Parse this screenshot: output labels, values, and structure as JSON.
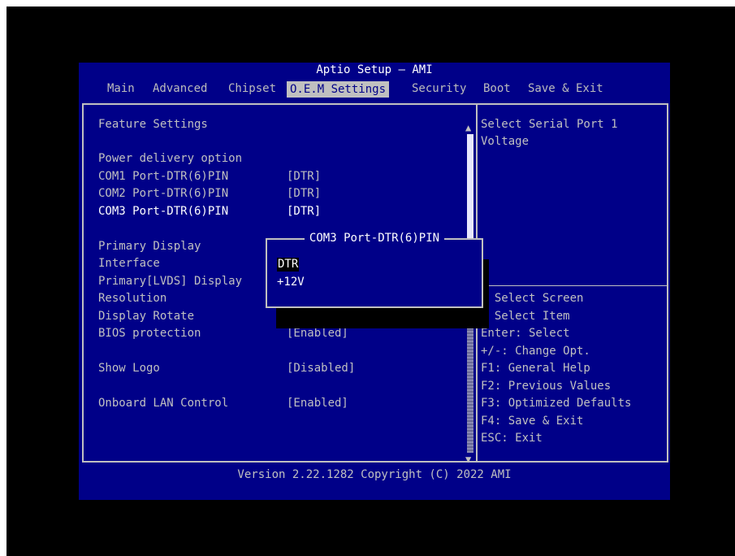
{
  "title": "Aptio Setup – AMI",
  "tabs": [
    {
      "label": "Main"
    },
    {
      "label": "Advanced"
    },
    {
      "label": "Chipset"
    },
    {
      "label": "O.E.M Settings"
    },
    {
      "label": "Security"
    },
    {
      "label": "Boot"
    },
    {
      "label": "Save & Exit"
    }
  ],
  "active_tab": "O.E.M Settings",
  "settings": {
    "section_title": "Feature Settings",
    "power_delivery_label": "Power delivery option",
    "com1_label": "COM1 Port-DTR(6)PIN",
    "com1_value": "[DTR]",
    "com2_label": "COM2 Port-DTR(6)PIN",
    "com2_value": "[DTR]",
    "com3_label": "COM3 Port-DTR(6)PIN",
    "com3_value": "[DTR]",
    "primary_display_label": "Primary Display",
    "interface_label": "Interface",
    "primary_lvds_label": "Primary[LVDS] Display",
    "resolution_label": "Resolution",
    "display_rotate_label": "Display Rotate",
    "bios_protection_label": "BIOS protection",
    "bios_protection_value": "[Enabled]",
    "show_logo_label": "Show Logo",
    "show_logo_value": "[Disabled]",
    "onboard_lan_label": "Onboard LAN Control",
    "onboard_lan_value": "[Enabled]"
  },
  "help": {
    "description_line1": "Select Serial Port 1",
    "description_line2": "Voltage",
    "keys": [
      "  Select Screen",
      "  Select Item",
      "Enter: Select",
      "+/-: Change Opt.",
      "F1: General Help",
      "F2: Previous Values",
      "F3: Optimized Defaults",
      "F4: Save & Exit",
      "ESC: Exit"
    ]
  },
  "popup": {
    "title": "COM3 Port-DTR(6)PIN",
    "options": [
      "DTR",
      "+12V"
    ],
    "selected": "DTR"
  },
  "footer": "Version 2.22.1282 Copyright (C) 2022 AMI",
  "colors": {
    "background": "#000088",
    "text": "#c0c0c0",
    "highlight": "#ffffff"
  }
}
